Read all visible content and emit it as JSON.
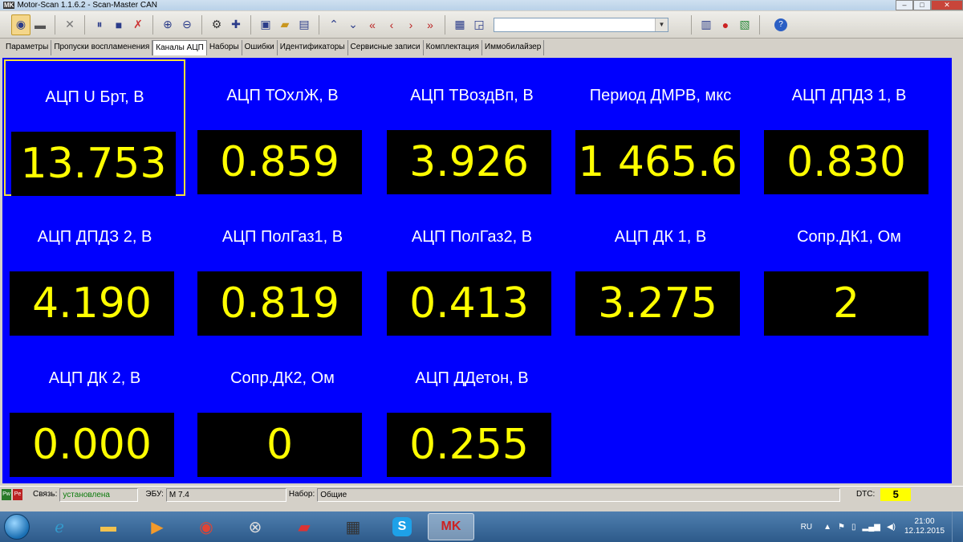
{
  "window": {
    "title": "Motor-Scan 1.1.6.2 - Scan-Master CAN",
    "logo": "MK",
    "controls": {
      "minimize": "–",
      "maximize": "□",
      "close": "✕"
    }
  },
  "toolbar": {
    "icons": [
      "connect-icon",
      "battery-icon",
      "tools-icon",
      "pause-icon",
      "stop-icon",
      "clear-icon",
      "zoom-in-icon",
      "zoom-out-icon",
      "settings-gear-icon",
      "add-icon",
      "save-icon",
      "open-folder-icon",
      "export-icon",
      "up-icon",
      "down-icon",
      "first-icon",
      "prev-icon",
      "next-icon",
      "last-icon",
      "monitor-icon",
      "window-icon",
      "report-icon",
      "record-icon",
      "excel-icon",
      "help-icon"
    ],
    "combo_value": ""
  },
  "tabs": [
    {
      "label": "Параметры"
    },
    {
      "label": "Пропуски воспламенения"
    },
    {
      "label": "Каналы АЦП",
      "active": true
    },
    {
      "label": "Наборы"
    },
    {
      "label": "Ошибки"
    },
    {
      "label": "Идентификаторы"
    },
    {
      "label": "Сервисные записи"
    },
    {
      "label": "Комплектация"
    },
    {
      "label": "Иммобилайзер"
    }
  ],
  "channels": [
    {
      "label": "АЦП U Брт, В",
      "value": "13.753"
    },
    {
      "label": "АЦП ТОхлЖ, В",
      "value": "0.859"
    },
    {
      "label": "АЦП ТВоздВп, В",
      "value": "3.926"
    },
    {
      "label": "Период ДМРВ, мкс",
      "value": "1 465.6"
    },
    {
      "label": "АЦП ДПДЗ 1, В",
      "value": "0.830"
    },
    {
      "label": "АЦП ДПДЗ 2, В",
      "value": "4.190"
    },
    {
      "label": "АЦП ПолГаз1, В",
      "value": "0.819"
    },
    {
      "label": "АЦП ПолГаз2, В",
      "value": "0.413"
    },
    {
      "label": "АЦП ДК 1, В",
      "value": "3.275"
    },
    {
      "label": "Сопр.ДК1, Ом",
      "value": "2"
    },
    {
      "label": "АЦП ДК 2, В",
      "value": "0.000"
    },
    {
      "label": "Сопр.ДК2, Ом",
      "value": "0"
    },
    {
      "label": "АЦП ДДетон, В",
      "value": "0.255"
    }
  ],
  "status": {
    "pw_label": "Pw",
    "pe_label": "Pe",
    "connection_label": "Связь:",
    "connection_value": "установлена",
    "ecu_label": "ЭБУ:",
    "ecu_value": "M 7.4",
    "set_label": "Набор:",
    "set_value": "Общие",
    "dtc_label": "DTC:",
    "dtc_value": "5"
  },
  "taskbar": {
    "apps": [
      "ie-icon",
      "explorer-icon",
      "media-player-icon",
      "chrome-icon",
      "toyota-icon",
      "car-icon",
      "chip-icon",
      "skype-icon",
      "motorscan-icon"
    ],
    "lang": "RU",
    "time": "21:00",
    "date": "12.12.2015"
  },
  "colors": {
    "panel_bg": "#0000fe",
    "value_fg": "#ffff00",
    "selection": "#f6e03a"
  }
}
